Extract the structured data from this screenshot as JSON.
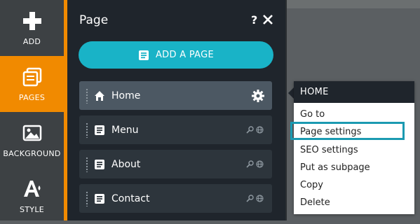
{
  "rail": {
    "items": [
      {
        "label": "ADD",
        "icon": "plus-icon",
        "active": false
      },
      {
        "label": "PAGES",
        "icon": "pages-icon",
        "active": true
      },
      {
        "label": "BACKGROUND",
        "icon": "image-icon",
        "active": false
      },
      {
        "label": "STYLE",
        "icon": "font-style-icon",
        "active": false
      }
    ]
  },
  "panel": {
    "title": "Page",
    "help": "?",
    "add_button_label": "ADD A PAGE",
    "pages": [
      {
        "label": "Home",
        "icon": "home-icon",
        "selected": true
      },
      {
        "label": "Menu",
        "icon": "page-icon",
        "selected": false
      },
      {
        "label": "About",
        "icon": "page-icon",
        "selected": false
      },
      {
        "label": "Contact",
        "icon": "page-icon",
        "selected": false
      }
    ]
  },
  "context_menu": {
    "title": "HOME",
    "items": [
      "Go to",
      "Page settings",
      "SEO settings",
      "Put as subpage",
      "Copy",
      "Delete"
    ],
    "highlighted": "Page settings"
  },
  "colors": {
    "accent_orange": "#f18a00",
    "accent_teal": "#19b3c7",
    "panel_bg": "#1f252c",
    "highlight_border": "#1b9ab1"
  }
}
